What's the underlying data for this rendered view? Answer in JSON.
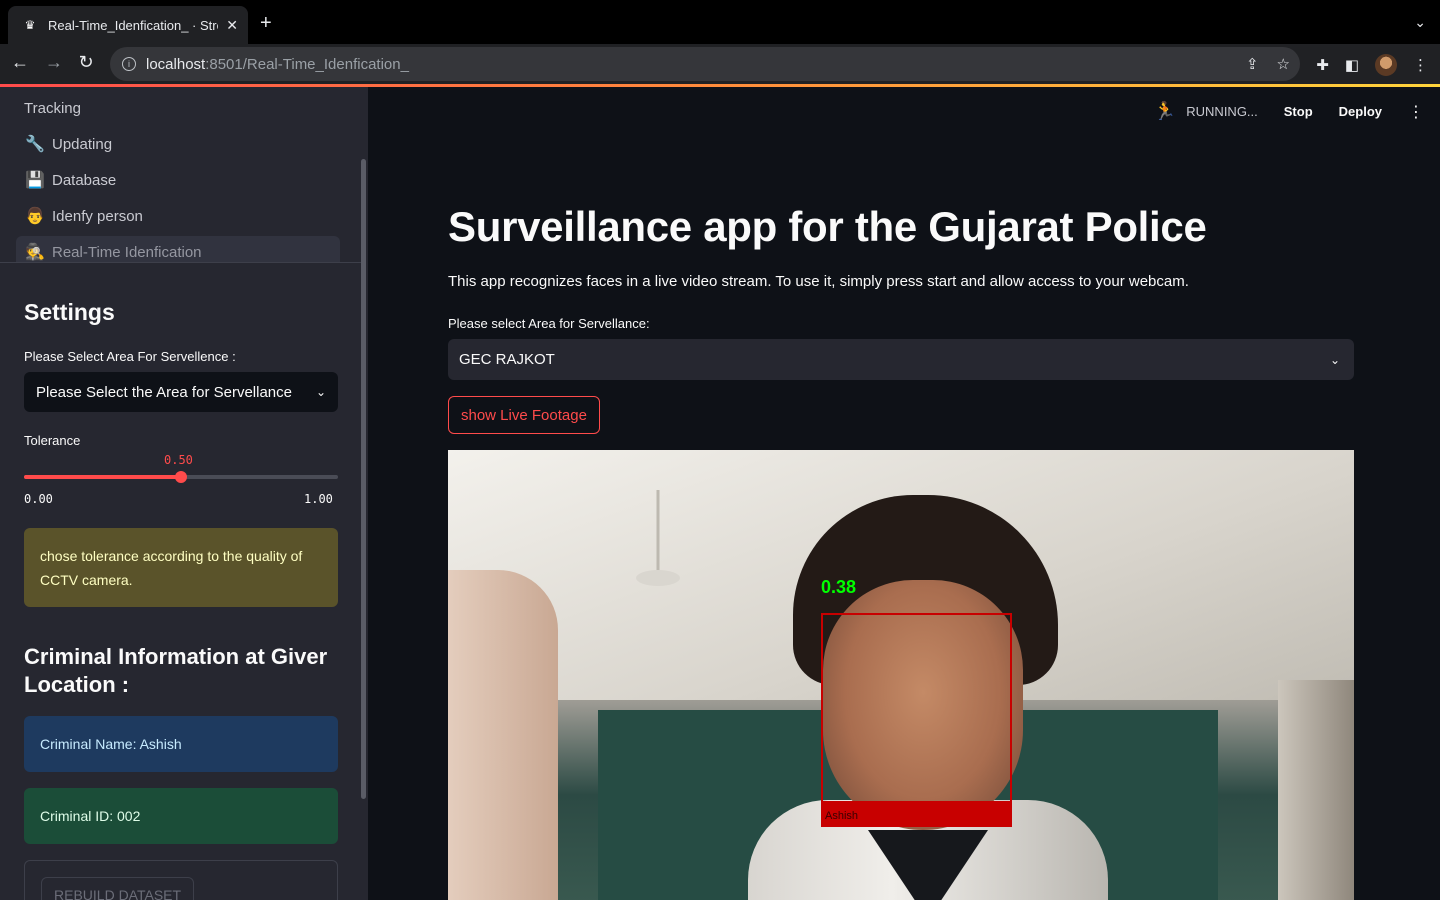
{
  "browser": {
    "tab_title": "Real-Time_Idenfication_ · Stre",
    "favicon": "streamlit-crown-icon",
    "url_host": "localhost",
    "url_rest": ":8501/Real-Time_Idenfication_"
  },
  "sidebar": {
    "nav": [
      {
        "label": "Tracking",
        "icon": ""
      },
      {
        "label": "Updating",
        "icon": "wrench-icon"
      },
      {
        "label": "Database",
        "icon": "floppy-disk-icon"
      },
      {
        "label": "Idenfy person",
        "icon": "person-icon"
      },
      {
        "label": "Real-Time Idenfication",
        "icon": "detective-icon"
      }
    ],
    "settings_heading": "Settings",
    "area_label": "Please Select Area For Servellence :",
    "area_value": "Please Select the Area for Servellance",
    "tolerance_label": "Tolerance",
    "tolerance_value": "0.50",
    "tolerance_fraction": 0.5,
    "tolerance_min": "0.00",
    "tolerance_max": "1.00",
    "tolerance_warning": "chose tolerance according to the quality of CCTV camera.",
    "criminal_heading": "Criminal Information at Giver Location :",
    "criminal_name": "Criminal Name: Ashish",
    "criminal_id": "Criminal ID: 002",
    "rebuild_button": "REBUILD DATASET"
  },
  "header": {
    "status": "RUNNING...",
    "stop": "Stop",
    "deploy": "Deploy"
  },
  "main": {
    "title": "Surveillance app for the Gujarat Police",
    "description": "This app recognizes faces in a live video stream. To use it, simply press start and allow access to your webcam.",
    "area_label": "Please select Area for Servellance:",
    "area_value": "GEC RAJKOT",
    "live_button": "show Live Footage",
    "detection": {
      "score": "0.38",
      "name": "Ashish"
    }
  },
  "colors": {
    "accent": "#ff4b4b",
    "sidebar_bg": "#262730",
    "main_bg": "#0e1117"
  }
}
